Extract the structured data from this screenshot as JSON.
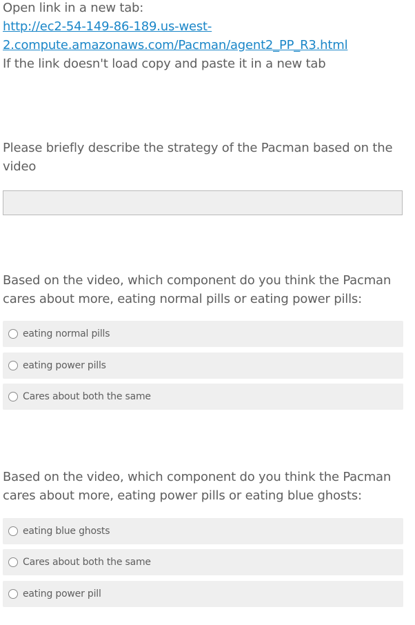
{
  "intro": {
    "open_link_label": "Open link in a new tab:",
    "link_line1": "http://ec2-54-149-86-189.us-west-",
    "link_line2": "2.compute.amazonaws.com/Pacman/agent2_PP_R3.html",
    "hint": "If the link doesn't load copy and paste it in a new tab"
  },
  "q1": {
    "line1": "Please briefly describe the strategy of the Pacman based on the",
    "line2": "video",
    "answer_value": ""
  },
  "q2": {
    "line1": "Based on the video, which component do you think the Pacman",
    "line2": "cares about more, eating normal pills or eating power pills:",
    "options": [
      "eating normal pills",
      "eating power pills",
      "Cares about both the same"
    ]
  },
  "q3": {
    "line1": "Based on the video, which component do you think the Pacman",
    "line2": "cares about more, eating power pills or eating blue ghosts:",
    "options": [
      "eating blue ghosts",
      "Cares about both the same",
      "eating power pill"
    ]
  }
}
